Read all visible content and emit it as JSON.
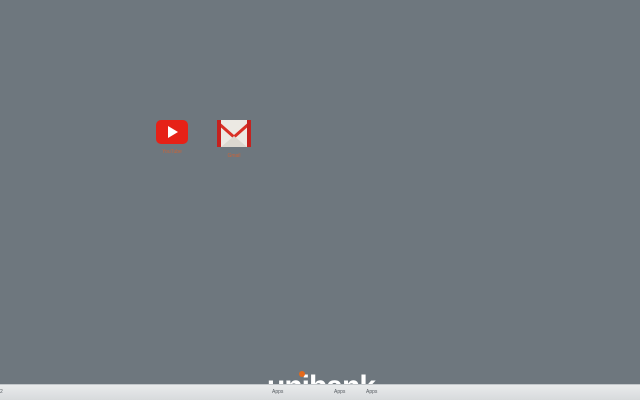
{
  "desktop": {
    "background_color": "#6e777e",
    "apps": [
      {
        "label": "YouTube",
        "icon": "youtube-icon",
        "color": "#e62117"
      },
      {
        "label": "Gmail",
        "icon": "gmail-icon",
        "color": "#d93025"
      }
    ]
  },
  "brand": {
    "logo_text": "unibank",
    "logo_color": "#ffffff",
    "accent_color": "#e46a1c"
  },
  "taskbar": {
    "edge_mark": "2",
    "items": [
      "Apps",
      "Apps",
      "Apps"
    ]
  }
}
